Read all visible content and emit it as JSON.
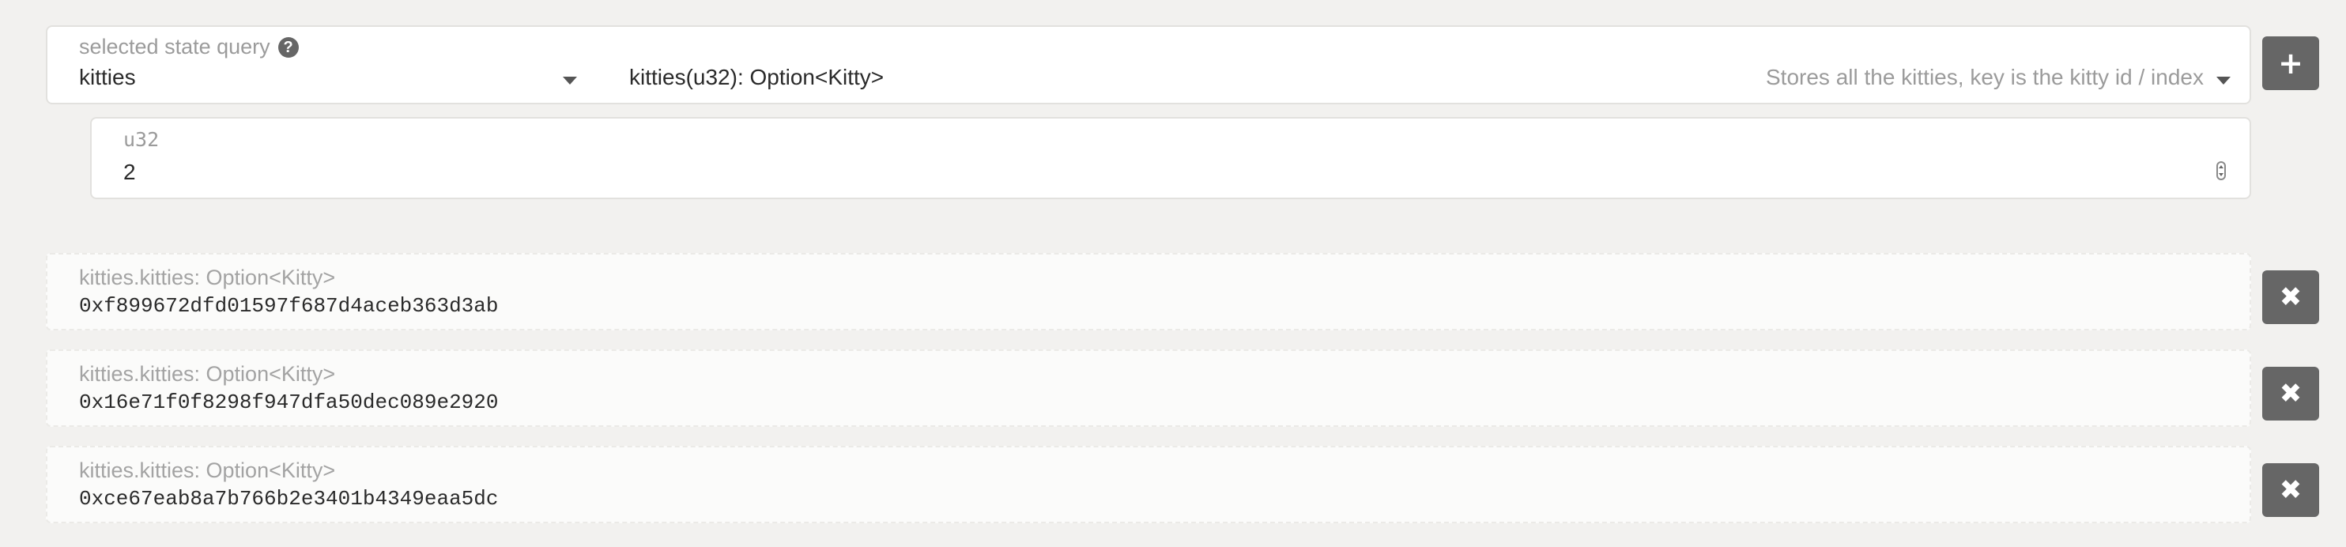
{
  "query": {
    "label": "selected state query",
    "help_icon": "?",
    "module": "kitties",
    "method": "kitties(u32): Option<Kitty>",
    "doc": "Stores all the kitties, key is the kitty id / index",
    "add_icon": "+"
  },
  "param": {
    "type_label": "u32",
    "value": "2"
  },
  "results": [
    {
      "label": "kitties.kitties: Option<Kitty>",
      "value": "0xf899672dfd01597f687d4aceb363d3ab"
    },
    {
      "label": "kitties.kitties: Option<Kitty>",
      "value": "0x16e71f0f8298f947dfa50dec089e2920"
    },
    {
      "label": "kitties.kitties: Option<Kitty>",
      "value": "0xce67eab8a7b766b2e3401b4349eaa5dc"
    }
  ],
  "close_icon": "✖",
  "colors": {
    "background": "#f2f1ef",
    "button": "#666666",
    "muted_text": "#9b9b9b"
  }
}
